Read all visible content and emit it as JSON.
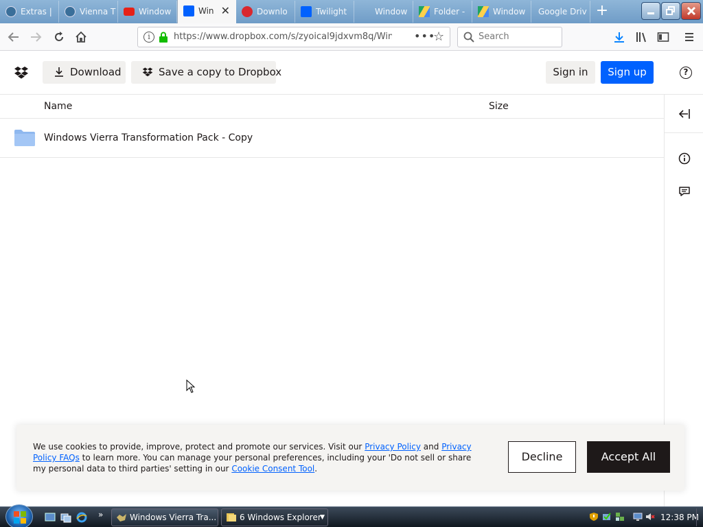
{
  "browser": {
    "tabs": [
      {
        "label": "Extras | ",
        "icon": "wordpress-icon",
        "active": false
      },
      {
        "label": "Vienna T",
        "icon": "wordpress-icon",
        "active": false
      },
      {
        "label": "Window",
        "icon": "youtube-icon",
        "active": false
      },
      {
        "label": "Win",
        "icon": "dropbox-icon",
        "active": true
      },
      {
        "label": "Downlo",
        "icon": "mega-icon",
        "active": false
      },
      {
        "label": "Twilight",
        "icon": "dropbox-icon",
        "active": false
      },
      {
        "label": "Window",
        "icon": "blank-icon",
        "active": false
      },
      {
        "label": "Folder -",
        "icon": "google-drive-icon",
        "active": false
      },
      {
        "label": "Window",
        "icon": "google-drive-icon",
        "active": false
      },
      {
        "label": "Google Driv",
        "icon": "none",
        "active": false
      }
    ],
    "new_tab": "+",
    "url": "https://www.dropbox.com/s/zyoical9jdxvm8q/Wind",
    "search_placeholder": "Search"
  },
  "dropbox": {
    "download_label": "Download",
    "save_copy_label": "Save a copy to Dropbox",
    "sign_in_label": "Sign in",
    "sign_up_label": "Sign up",
    "help": "?"
  },
  "file_list": {
    "col_name": "Name",
    "col_size": "Size",
    "rows": [
      {
        "name": "Windows Vierra Transformation Pack - Copy",
        "size": ""
      }
    ]
  },
  "cookie_banner": {
    "text_1": "We use cookies to provide, improve, protect and promote our services. Visit our ",
    "link_1": "Privacy Policy",
    "text_2": " and ",
    "link_2": "Privacy Policy FAQs",
    "text_3": " to learn more. You can manage your personal preferences, including your 'Do not sell or share my personal data to third parties' setting in our ",
    "link_3": "Cookie Consent Tool",
    "text_4": ".",
    "decline_label": "Decline",
    "accept_label": "Accept All"
  },
  "taskbar": {
    "task_1": "Windows Vierra Tra...",
    "task_2": "6 Windows Explorer",
    "quick_launch_more": "»",
    "clock": "12:38 PM"
  },
  "colors": {
    "dropbox_blue": "#0061fe",
    "text_dark": "#1e1919",
    "folder": "#8fb8ef"
  }
}
